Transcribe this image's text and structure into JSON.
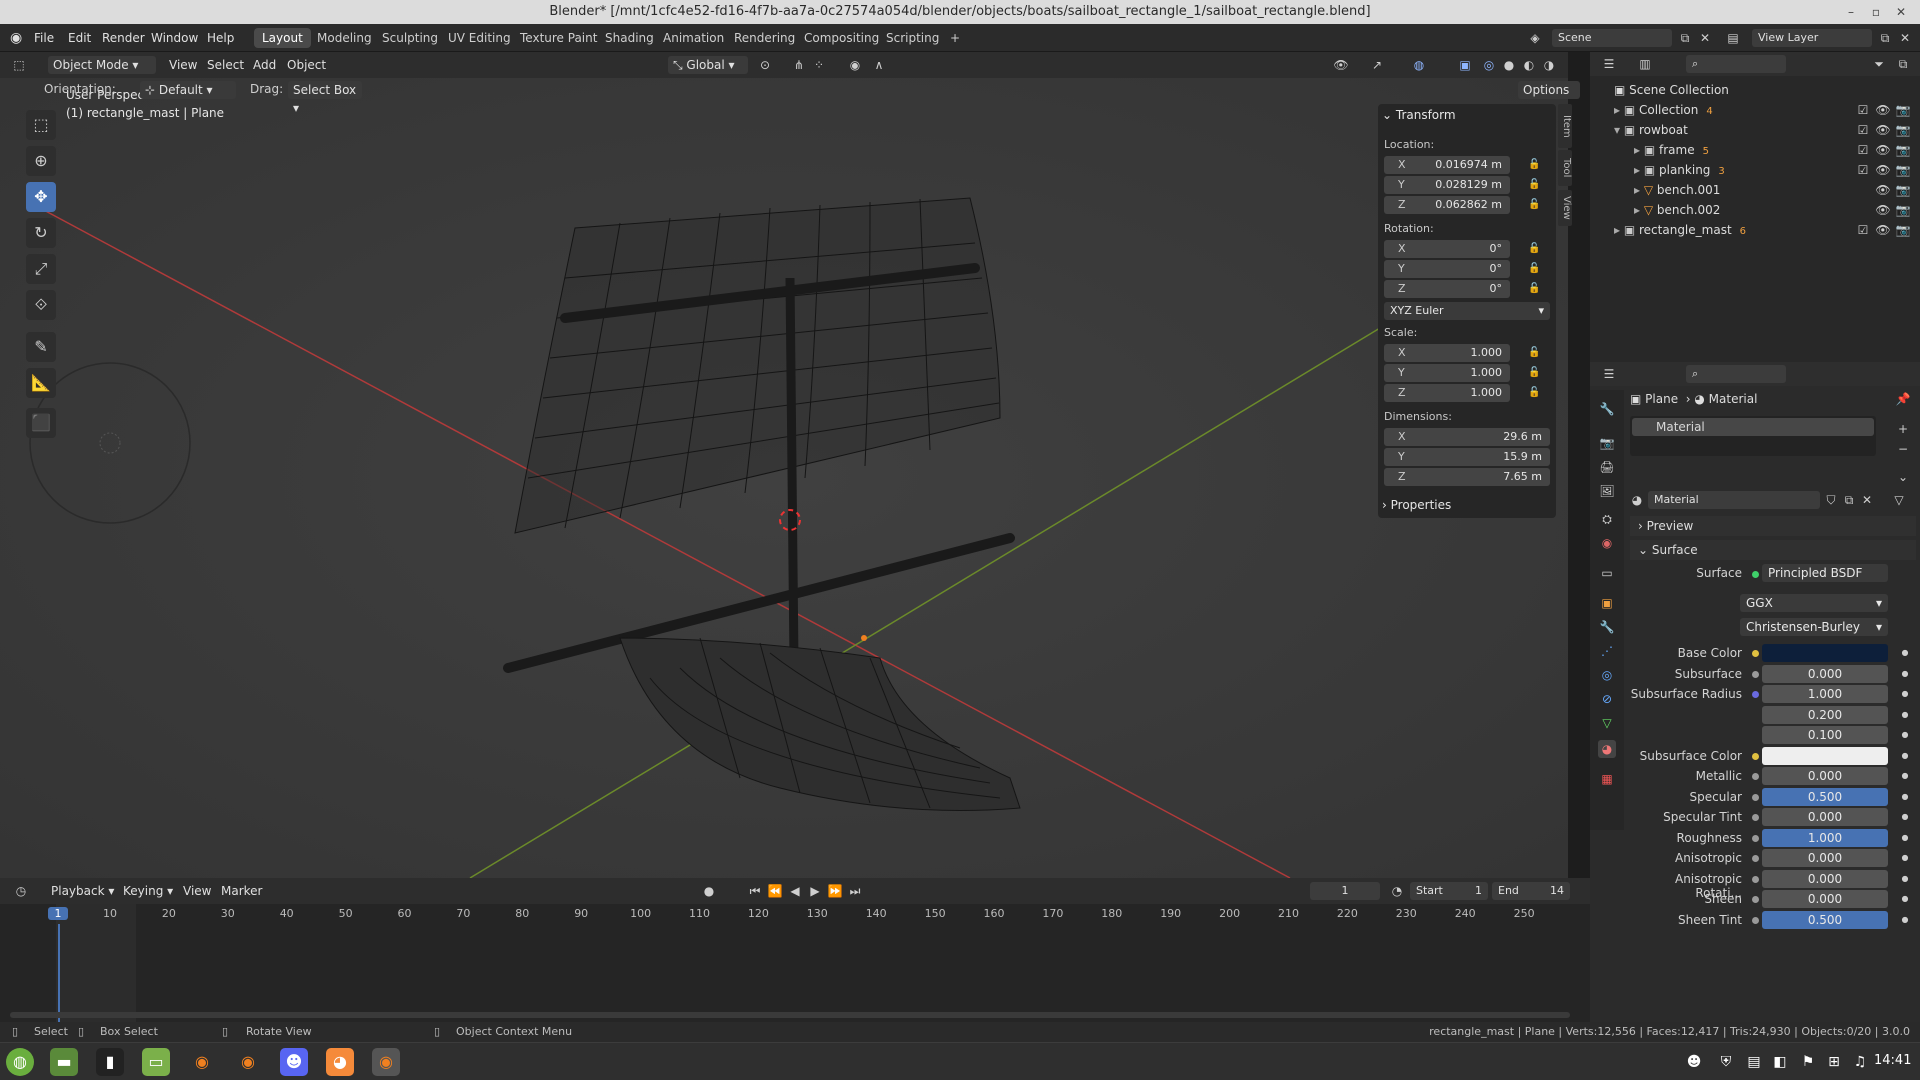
{
  "app": {
    "title": "Blender* [/mnt/1cfc4e52-fd16-4f7b-aa7a-0c27574a054d/blender/objects/boats/sailboat_rectangle_1/sailboat_rectangle.blend]"
  },
  "menu": [
    "File",
    "Edit",
    "Render",
    "Window",
    "Help"
  ],
  "workspaces": [
    "Layout",
    "Modeling",
    "Sculpting",
    "UV Editing",
    "Texture Paint",
    "Shading",
    "Animation",
    "Rendering",
    "Compositing",
    "Scripting"
  ],
  "workspace_add": "+",
  "scene": "Scene",
  "view_layer": "View Layer",
  "header3d": {
    "mode": "Object Mode",
    "view": "View",
    "select": "Select",
    "add": "Add",
    "object": "Object",
    "transform_space": "Global",
    "orientation_label": "Orientation:",
    "orientation": "Default",
    "drag_label": "Drag:",
    "drag": "Select Box",
    "options": "Options"
  },
  "viewport": {
    "perspective": "User Perspective",
    "object": "(1) rectangle_mast | Plane"
  },
  "npanel": {
    "tabs": [
      "Item",
      "Tool",
      "View"
    ],
    "transform_title": "Transform",
    "location_label": "Location:",
    "location": [
      {
        "axis": "X",
        "value": "0.016974 m"
      },
      {
        "axis": "Y",
        "value": "0.028129 m"
      },
      {
        "axis": "Z",
        "value": "0.062862 m"
      }
    ],
    "rotation_label": "Rotation:",
    "rotation": [
      {
        "axis": "X",
        "value": "0°"
      },
      {
        "axis": "Y",
        "value": "0°"
      },
      {
        "axis": "Z",
        "value": "0°"
      }
    ],
    "rotation_mode": "XYZ Euler",
    "scale_label": "Scale:",
    "scale": [
      {
        "axis": "X",
        "value": "1.000"
      },
      {
        "axis": "Y",
        "value": "1.000"
      },
      {
        "axis": "Z",
        "value": "1.000"
      }
    ],
    "dimensions_label": "Dimensions:",
    "dimensions": [
      {
        "axis": "X",
        "value": "29.6 m"
      },
      {
        "axis": "Y",
        "value": "15.9 m"
      },
      {
        "axis": "Z",
        "value": "7.65 m"
      }
    ],
    "properties": "Properties"
  },
  "outliner": {
    "root": "Scene Collection",
    "items": [
      {
        "name": "Collection",
        "badge": "4"
      },
      {
        "name": "rowboat",
        "badge": ""
      },
      {
        "name": "frame",
        "badge": "5"
      },
      {
        "name": "planking",
        "badge": "3"
      },
      {
        "name": "bench.001",
        "badge": ""
      },
      {
        "name": "bench.002",
        "badge": ""
      },
      {
        "name": "rectangle_mast",
        "badge": "6"
      }
    ]
  },
  "props": {
    "breadcrumb_obj": "Plane",
    "breadcrumb_mat": "Material",
    "slot": "Material",
    "material_name": "Material",
    "preview": "Preview",
    "surface_header": "Surface",
    "surface_label": "Surface",
    "surface_value": "Principled BSDF",
    "distribution": "GGX",
    "subsurface_method": "Christensen-Burley",
    "fields": [
      {
        "label": "Base Color",
        "value": "",
        "kind": "color",
        "color": "#0d1f3a"
      },
      {
        "label": "Subsurface",
        "value": "0.000",
        "kind": "num"
      },
      {
        "label": "Subsurface Radius",
        "value": "1.000",
        "kind": "num"
      },
      {
        "label": "",
        "value": "0.200",
        "kind": "num"
      },
      {
        "label": "",
        "value": "0.100",
        "kind": "num"
      },
      {
        "label": "Subsurface Color",
        "value": "",
        "kind": "color",
        "color": "#eeeeee"
      },
      {
        "label": "Metallic",
        "value": "0.000",
        "kind": "num"
      },
      {
        "label": "Specular",
        "value": "0.500",
        "kind": "blue"
      },
      {
        "label": "Specular Tint",
        "value": "0.000",
        "kind": "num"
      },
      {
        "label": "Roughness",
        "value": "1.000",
        "kind": "blue"
      },
      {
        "label": "Anisotropic",
        "value": "0.000",
        "kind": "num"
      },
      {
        "label": "Anisotropic Rotati...",
        "value": "0.000",
        "kind": "num"
      },
      {
        "label": "Sheen",
        "value": "0.000",
        "kind": "num"
      },
      {
        "label": "Sheen Tint",
        "value": "0.500",
        "kind": "blue"
      }
    ]
  },
  "timeline": {
    "menus": [
      "Playback",
      "Keying",
      "View",
      "Marker"
    ],
    "current": "1",
    "start_label": "Start",
    "start": "1",
    "end_label": "End",
    "end": "14",
    "ticks": [
      "1",
      "10",
      "20",
      "30",
      "40",
      "50",
      "60",
      "70",
      "80",
      "90",
      "100",
      "110",
      "120",
      "130",
      "140",
      "150",
      "160",
      "170",
      "180",
      "190",
      "200",
      "210",
      "220",
      "230",
      "240",
      "250"
    ]
  },
  "status": {
    "select": "Select",
    "box_select": "Box Select",
    "rotate_view": "Rotate View",
    "context_menu": "Object Context Menu",
    "stats": "rectangle_mast | Plane | Verts:12,556 | Faces:12,417 | Tris:24,930 | Objects:0/20 | 3.0.0"
  },
  "taskbar": {
    "time": "14:41"
  }
}
